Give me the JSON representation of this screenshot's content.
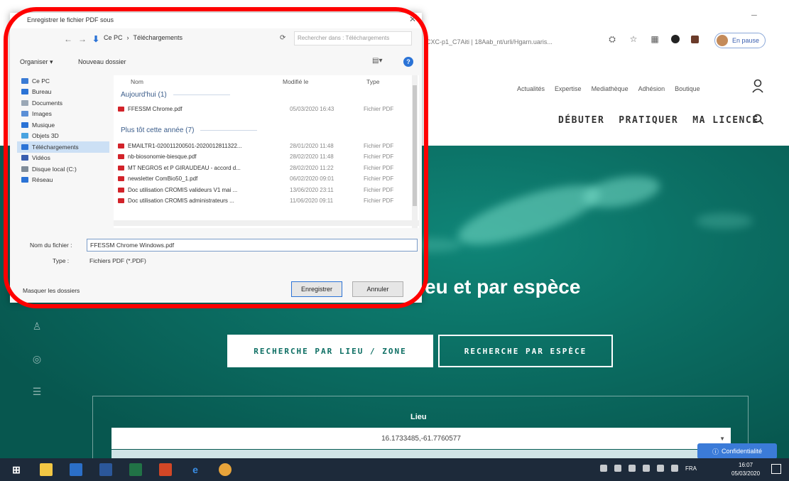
{
  "browser": {
    "address": "CXC-p1_C7Aiti | 18Aab_nt/urli/Hgarn.uaris...",
    "profile_label": "En pause",
    "minimize": "–"
  },
  "site": {
    "top_links": [
      "Actualités",
      "Expertise",
      "Mediathèque",
      "Adhésion",
      "Boutique"
    ],
    "nav": [
      "DÉBUTER",
      "PRATIQUER",
      "MA LICENCE"
    ],
    "hero_title": "eu et par espèce",
    "tab_lieu": "RECHERCHE PAR LIEU / ZONE",
    "tab_espece": "RECHERCHE PAR ESPÈCE",
    "lieu_label": "Lieu",
    "lieu_value": "16.1733485,-61.7760577",
    "confidentiality": "Confidentialité"
  },
  "dialog": {
    "title": "Enregistrer le fichier PDF sous",
    "breadcrumb": [
      "Ce PC",
      "Téléchargements"
    ],
    "search_placeholder": "Rechercher dans : Téléchargements",
    "organize": "Organiser ▾",
    "new_folder": "Nouveau dossier",
    "help": "?",
    "nav_items": [
      {
        "label": "Ce PC",
        "color": "#3a7bd5"
      },
      {
        "label": "Bureau",
        "color": "#2b73d6"
      },
      {
        "label": "Documents",
        "color": "#9aa7b5"
      },
      {
        "label": "Images",
        "color": "#5b8fd6"
      },
      {
        "label": "Musique",
        "color": "#2b73d6"
      },
      {
        "label": "Objets 3D",
        "color": "#4aa3e0"
      },
      {
        "label": "Téléchargements",
        "color": "#2b73d6"
      },
      {
        "label": "Vidéos",
        "color": "#3a5fb0"
      },
      {
        "label": "Disque local (C:)",
        "color": "#7f8c99"
      },
      {
        "label": "Réseau",
        "color": "#2b73d6"
      }
    ],
    "columns": {
      "name": "Nom",
      "modified": "Modifié le",
      "type": "Type"
    },
    "group_today": "Aujourd'hui (1)",
    "group_earlier": "Plus tôt cette année (7)",
    "files_today": [
      {
        "name": "FFESSM Chrome.pdf",
        "date": "05/03/2020 16:43",
        "type": "Fichier PDF"
      }
    ],
    "files_earlier": [
      {
        "name": "EMAILTR1-020011200501-2020012811322...",
        "date": "28/01/2020 11:48",
        "type": "Fichier PDF"
      },
      {
        "name": "nb-biosonomie-biesque.pdf",
        "date": "28/02/2020 11:48",
        "type": "Fichier PDF"
      },
      {
        "name": "MT NEGROS et P GIRAUDEAU - accord d...",
        "date": "28/02/2020 11:22",
        "type": "Fichier PDF"
      },
      {
        "name": "newsletter ComBio50_1.pdf",
        "date": "06/02/2020 09:01",
        "type": "Fichier PDF"
      },
      {
        "name": "Doc utilisation CROMIS valideurs V1 mai ...",
        "date": "13/06/2020 23:11",
        "type": "Fichier PDF"
      },
      {
        "name": "Doc utilisation CROMIS administrateurs ...",
        "date": "11/06/2020 09:11",
        "type": "Fichier PDF"
      }
    ],
    "filename_label": "Nom du fichier :",
    "filename_value": "FFESSM Chrome Windows.pdf",
    "type_label": "Type :",
    "type_value": "Fichiers PDF (*.PDF)",
    "hide_folders": "Masquer les dossiers",
    "save_label": "Enregistrer",
    "cancel_label": "Annuler"
  },
  "taskbar": {
    "lang": "FRA",
    "time": "16:07",
    "date": "05/03/2020"
  },
  "colors": {
    "highlight": "#ff0000",
    "hero": "#0b6d62",
    "taskbar": "#1d2a3a"
  }
}
